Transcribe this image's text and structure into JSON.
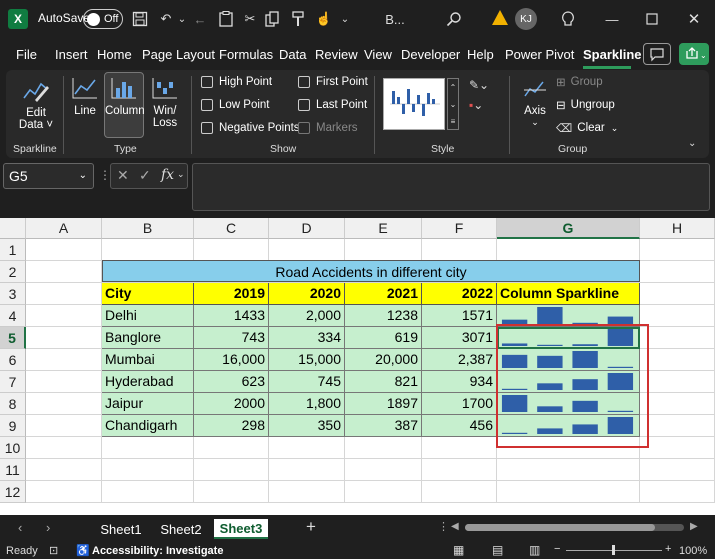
{
  "titlebar": {
    "autosave_label": "AutoSave",
    "toggle_state": "Off",
    "doc_name": "B...",
    "user_initials": "KJ"
  },
  "menu": [
    "File",
    "Insert",
    "Home",
    "Page Layout",
    "Formulas",
    "Data",
    "Review",
    "View",
    "Developer",
    "Help",
    "Power Pivot",
    "Sparkline"
  ],
  "ribbon": {
    "edit_data": "Edit",
    "edit_data2": "Data ˅",
    "line": "Line",
    "column": "Column",
    "winloss1": "Win/",
    "winloss2": "Loss",
    "high_point": "High Point",
    "low_point": "Low Point",
    "negative_points": "Negative Points",
    "first_point": "First Point",
    "last_point": "Last Point",
    "markers": "Markers",
    "axis": "Axis",
    "group": "Group",
    "ungroup": "Ungroup",
    "clear": "Clear",
    "groups": {
      "sparkline": "Sparkline",
      "type": "Type",
      "show": "Show",
      "style": "Style",
      "group": "Group"
    }
  },
  "namebox": "G5",
  "fx": "fx",
  "columns": [
    "A",
    "B",
    "C",
    "D",
    "E",
    "F",
    "G",
    "H"
  ],
  "rows": [
    "1",
    "2",
    "3",
    "4",
    "5",
    "6",
    "7",
    "8",
    "9",
    "10",
    "11",
    "12"
  ],
  "table": {
    "title": "Road Accidents in different city",
    "headers": [
      "City",
      "2019",
      "2020",
      "2021",
      "2022",
      "Column Sparkline"
    ],
    "rows": [
      {
        "city": "Delhi",
        "v": [
          "1433",
          "2,000",
          "1238",
          "1571"
        ],
        "n": [
          1433,
          2000,
          1238,
          1571
        ]
      },
      {
        "city": "Banglore",
        "v": [
          "743",
          "334",
          "619",
          "3071"
        ],
        "n": [
          743,
          334,
          619,
          3071
        ]
      },
      {
        "city": "Mumbai",
        "v": [
          "16,000",
          "15,000",
          "20,000",
          "2,387"
        ],
        "n": [
          16000,
          15000,
          20000,
          2387
        ]
      },
      {
        "city": "Hyderabad",
        "v": [
          "623",
          "745",
          "821",
          "934"
        ],
        "n": [
          623,
          745,
          821,
          934
        ]
      },
      {
        "city": "Jaipur",
        "v": [
          "2000",
          "1,800",
          "1897",
          "1700"
        ],
        "n": [
          2000,
          1800,
          1897,
          1700
        ]
      },
      {
        "city": "Chandigarh",
        "v": [
          "298",
          "350",
          "387",
          "456"
        ],
        "n": [
          298,
          350,
          387,
          456
        ]
      }
    ]
  },
  "sheets": [
    "Sheet1",
    "Sheet2",
    "Sheet3"
  ],
  "status": {
    "ready": "Ready",
    "accessibility": "Accessibility: Investigate",
    "zoom": "100%"
  },
  "colors": {
    "sparkline": "#2f5fa8",
    "title_fill": "#87ceeb",
    "header_fill": "#ffff00",
    "data_fill": "#c6efce",
    "accent": "#217346"
  }
}
